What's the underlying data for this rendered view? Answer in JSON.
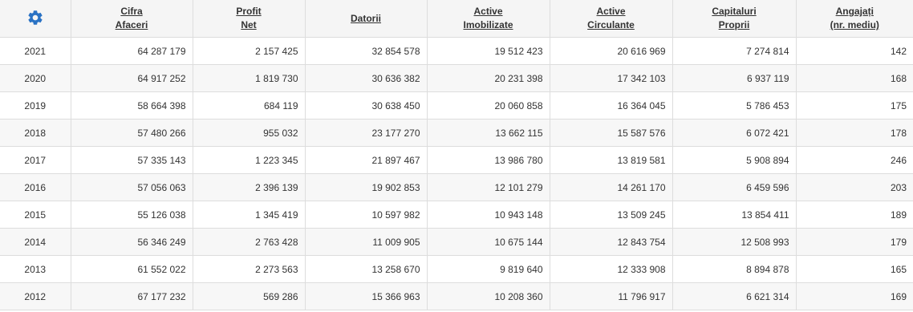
{
  "header": {
    "settings_icon": "gear-icon",
    "columns": [
      {
        "line1": "Cifra",
        "line2": "Afaceri"
      },
      {
        "line1": "Profit",
        "line2": "Net"
      },
      {
        "line1": "Datorii",
        "line2": ""
      },
      {
        "line1": "Active",
        "line2": "Imobilizate"
      },
      {
        "line1": "Active",
        "line2": "Circulante"
      },
      {
        "line1": "Capitaluri",
        "line2": "Proprii"
      },
      {
        "line1": "Angajați",
        "line2": "(nr. mediu)"
      }
    ]
  },
  "rows": [
    {
      "year": "2021",
      "cells": [
        "64 287 179",
        "2 157 425",
        "32 854 578",
        "19 512 423",
        "20 616 969",
        "7 274 814",
        "142"
      ]
    },
    {
      "year": "2020",
      "cells": [
        "64 917 252",
        "1 819 730",
        "30 636 382",
        "20 231 398",
        "17 342 103",
        "6 937 119",
        "168"
      ]
    },
    {
      "year": "2019",
      "cells": [
        "58 664 398",
        "684 119",
        "30 638 450",
        "20 060 858",
        "16 364 045",
        "5 786 453",
        "175"
      ]
    },
    {
      "year": "2018",
      "cells": [
        "57 480 266",
        "955 032",
        "23 177 270",
        "13 662 115",
        "15 587 576",
        "6 072 421",
        "178"
      ]
    },
    {
      "year": "2017",
      "cells": [
        "57 335 143",
        "1 223 345",
        "21 897 467",
        "13 986 780",
        "13 819 581",
        "5 908 894",
        "246"
      ]
    },
    {
      "year": "2016",
      "cells": [
        "57 056 063",
        "2 396 139",
        "19 902 853",
        "12 101 279",
        "14 261 170",
        "6 459 596",
        "203"
      ]
    },
    {
      "year": "2015",
      "cells": [
        "55 126 038",
        "1 345 419",
        "10 597 982",
        "10 943 148",
        "13 509 245",
        "13 854 411",
        "189"
      ]
    },
    {
      "year": "2014",
      "cells": [
        "56 346 249",
        "2 763 428",
        "11 009 905",
        "10 675 144",
        "12 843 754",
        "12 508 993",
        "179"
      ]
    },
    {
      "year": "2013",
      "cells": [
        "61 552 022",
        "2 273 563",
        "13 258 670",
        "9 819 640",
        "12 333 908",
        "8 894 878",
        "165"
      ]
    },
    {
      "year": "2012",
      "cells": [
        "67 177 232",
        "569 286",
        "15 366 963",
        "10 208 360",
        "11 796 917",
        "6 621 314",
        "169"
      ]
    }
  ],
  "colors": {
    "icon": "#2a72c4",
    "header_bg": "#f5f5f5",
    "row_alt_bg": "#f7f7f7",
    "border": "#dddddd",
    "text": "#333333"
  }
}
